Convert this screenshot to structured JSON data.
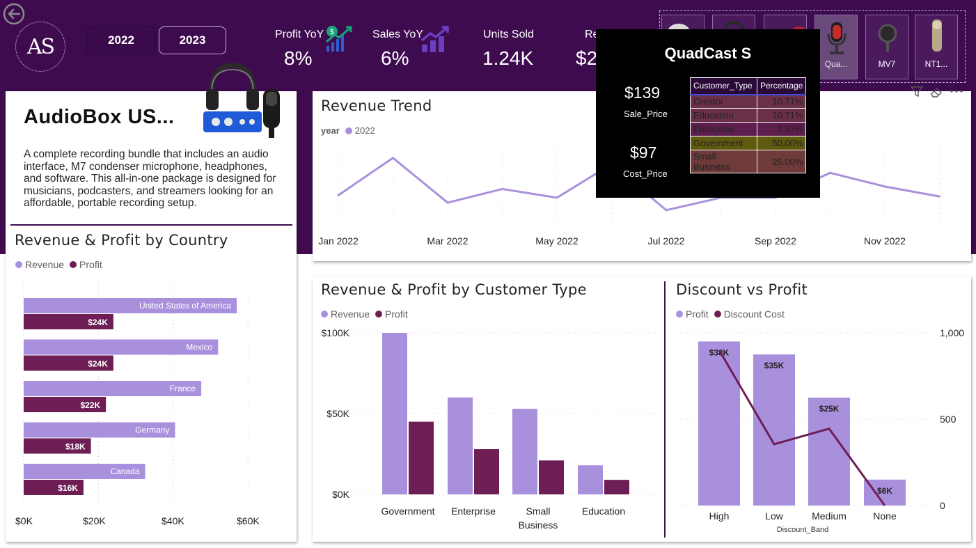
{
  "nav": {
    "back_icon": "back-arrow-icon"
  },
  "logo": {
    "text": "AS"
  },
  "years": [
    "2022",
    "2023"
  ],
  "kpis": [
    {
      "title": "Profit YoY",
      "value": "8%",
      "icon": "dollar-growth-icon"
    },
    {
      "title": "Sales YoY",
      "value": "6%",
      "icon": "bar-growth-icon"
    },
    {
      "title": "Units Sold",
      "value": "1.24K"
    },
    {
      "title": "Re",
      "value": "$2"
    }
  ],
  "product_thumbs": [
    {
      "label": ""
    },
    {
      "label": ""
    },
    {
      "label": ""
    },
    {
      "label": "Qua..."
    },
    {
      "label": "MV7"
    },
    {
      "label": "NT1..."
    }
  ],
  "tooltip": {
    "title": "QuadCast S",
    "sale_price": "$139",
    "sale_price_label": "Sale_Price",
    "cost_price": "$97",
    "cost_price_label": "Cost_Price",
    "table_headers": [
      "Customer_Type",
      "Percentage"
    ],
    "rows": [
      {
        "type": "Creator",
        "pct": "10.71%",
        "color": "#6b2f4a"
      },
      {
        "type": "Education",
        "pct": "10.71%",
        "color": "#6b2f4a"
      },
      {
        "type": "Enterprise",
        "pct": "3.57%",
        "color": "#5e1f4e"
      },
      {
        "type": "Government",
        "pct": "50.00%",
        "color": "#5f5a10"
      },
      {
        "type": "Small Business",
        "pct": "25.00%",
        "color": "#6e3a3a"
      }
    ]
  },
  "product_card": {
    "title": "AudioBox US...",
    "description": "A complete recording bundle that includes an audio interface, M7 condenser microphone, headphones, and software. This all-in-one package is designed for musicians, podcasters, and streamers looking for an affordable, portable recording setup."
  },
  "colors": {
    "revenue": "#a990dd",
    "profit": "#6d1f55",
    "band": "#3e0b4f"
  },
  "visual_header": {
    "icons": [
      "filter-icon",
      "eraser-icon",
      "more-options-icon"
    ]
  },
  "charts": {
    "country": {
      "title": "Revenue & Profit by Country",
      "legend": [
        "Revenue",
        "Profit"
      ],
      "x_ticks": [
        "$0K",
        "$20K",
        "$40K",
        "$60K"
      ]
    },
    "trend": {
      "title": "Revenue Trend",
      "legend_label": "year",
      "legend_item": "2022",
      "x_ticks": [
        "Jan 2022",
        "Mar 2022",
        "May 2022",
        "Jul 2022",
        "Sep 2022",
        "Nov 2022"
      ]
    },
    "customer": {
      "title": "Revenue & Profit by Customer Type",
      "legend": [
        "Revenue",
        "Profit"
      ],
      "y_ticks": [
        "$100K",
        "$50K",
        "$0K"
      ],
      "categories": [
        "Government",
        "Enterprise",
        "Small Business",
        "Education"
      ]
    },
    "discount": {
      "title": "Discount vs Profit",
      "legend": [
        "Profit",
        "Discount Cost"
      ],
      "y2_ticks": [
        "1,000",
        "500",
        "0"
      ],
      "xlabel": "Discount_Band",
      "bar_labels": [
        "$38K",
        "$35K",
        "$25K",
        "$6K"
      ]
    }
  },
  "chart_data": [
    {
      "type": "bar",
      "title": "Revenue & Profit by Country",
      "orientation": "horizontal",
      "categories": [
        "United States of America",
        "Mexico",
        "France",
        "Germany",
        "Canada"
      ],
      "series": [
        {
          "name": "Revenue",
          "values": [
            57,
            52,
            47.5,
            40.5,
            32.5
          ]
        },
        {
          "name": "Profit",
          "values": [
            24,
            24,
            22,
            18,
            16
          ]
        }
      ],
      "data_labels": [
        "$24K",
        "$24K",
        "$22K",
        "$18K",
        "$16K"
      ],
      "xlim": [
        0,
        65
      ],
      "legend": "top-left"
    },
    {
      "type": "line",
      "title": "Revenue Trend",
      "x": [
        "Jan 2022",
        "Feb 2022",
        "Mar 2022",
        "Apr 2022",
        "May 2022",
        "Jun 2022",
        "Jul 2022",
        "Aug 2022",
        "Sep 2022",
        "Oct 2022",
        "Nov 2022",
        "Dec 2022"
      ],
      "series": [
        {
          "name": "2022",
          "values": [
            7.5,
            10.5,
            6.9,
            8.0,
            7.3,
            10.0,
            6.3,
            7.3,
            7.3,
            9.3,
            8.2,
            7.4
          ]
        }
      ],
      "ylim": [
        5,
        12
      ],
      "legend": "top-left"
    },
    {
      "type": "bar",
      "title": "Revenue & Profit by Customer Type",
      "categories": [
        "Government",
        "Enterprise",
        "Small Business",
        "Education"
      ],
      "series": [
        {
          "name": "Revenue",
          "values": [
            100,
            60,
            53,
            18
          ]
        },
        {
          "name": "Profit",
          "values": [
            45,
            28,
            21,
            9
          ]
        }
      ],
      "ylim": [
        0,
        100
      ],
      "y_unit": "$K",
      "legend": "top-left"
    },
    {
      "type": "bar",
      "title": "Discount vs Profit",
      "categories": [
        "High",
        "Low",
        "Medium",
        "None"
      ],
      "series": [
        {
          "name": "Profit",
          "values": [
            38,
            35,
            25,
            6
          ],
          "axis": "left"
        },
        {
          "name": "Discount Cost",
          "values": [
            900,
            355,
            445,
            0
          ],
          "axis": "right",
          "type": "line"
        }
      ],
      "data_labels": [
        "$38K",
        "$35K",
        "$25K",
        "$6K"
      ],
      "y2lim": [
        0,
        1000
      ],
      "xlabel": "Discount_Band",
      "legend": "top-left"
    }
  ]
}
